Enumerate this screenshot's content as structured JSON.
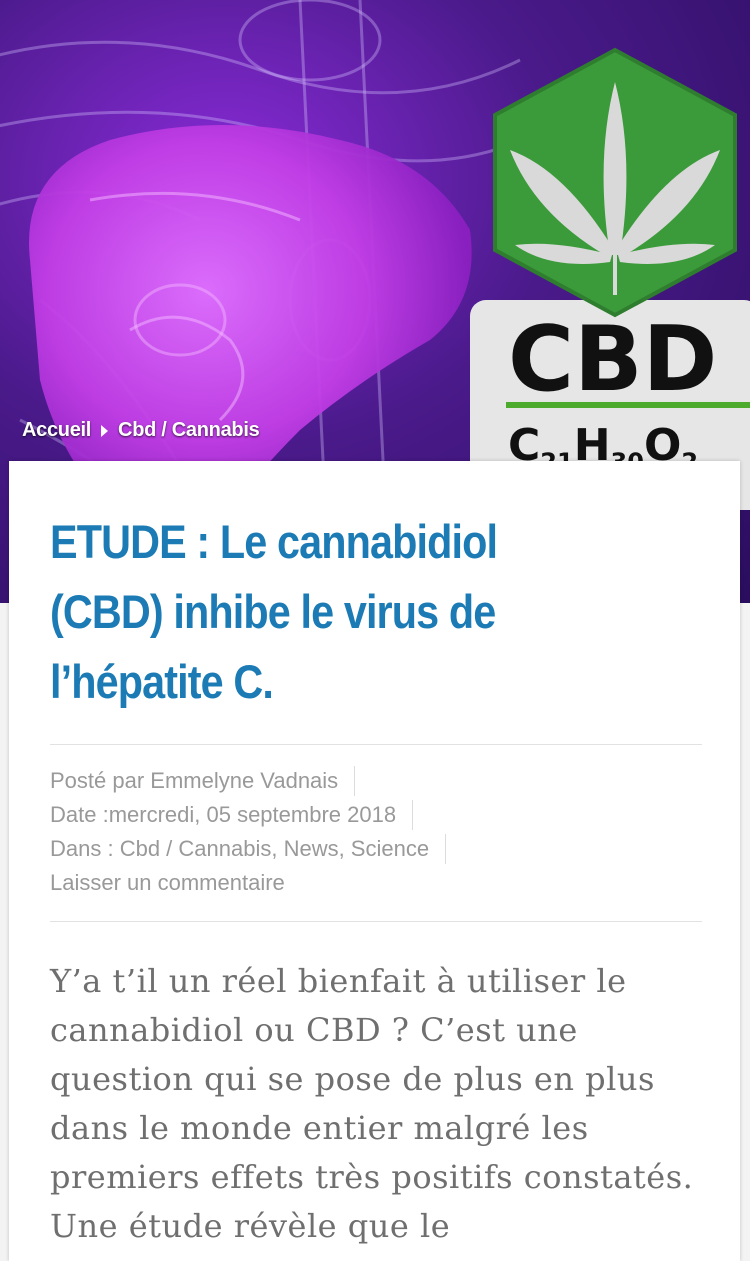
{
  "hero": {
    "logo_text": "CBD",
    "formula": "C21H30O2",
    "colors": {
      "background": "#5b1fa8",
      "liver": "#c040e8",
      "hexagon": "#3b9b3a",
      "leaf": "#d9d9d9",
      "label_bg": "#e6e6e6",
      "label_line": "#4caa2c"
    }
  },
  "breadcrumb": {
    "home": "Accueil",
    "separator_icon": "caret-right-icon",
    "category": "Cbd / Cannabis"
  },
  "article": {
    "title": "ETUDE : Le cannabidiol (CBD) inhibe le virus de l’hépatite C.",
    "title_color": "#1c7bb5",
    "meta": {
      "author": "Posté par Emmelyne Vadnais",
      "date": "Date :mercredi, 05 septembre 2018",
      "categories": "Dans : Cbd / Cannabis, News, Science",
      "comment_link": "Laisser un commentaire"
    },
    "body": "Y’a t’il un réel bienfait à utiliser le cannabidiol ou CBD ? C’est une question qui se pose de plus en plus dans le monde entier malgré les premiers effets très positifs constatés. Une étude révèle que le"
  }
}
